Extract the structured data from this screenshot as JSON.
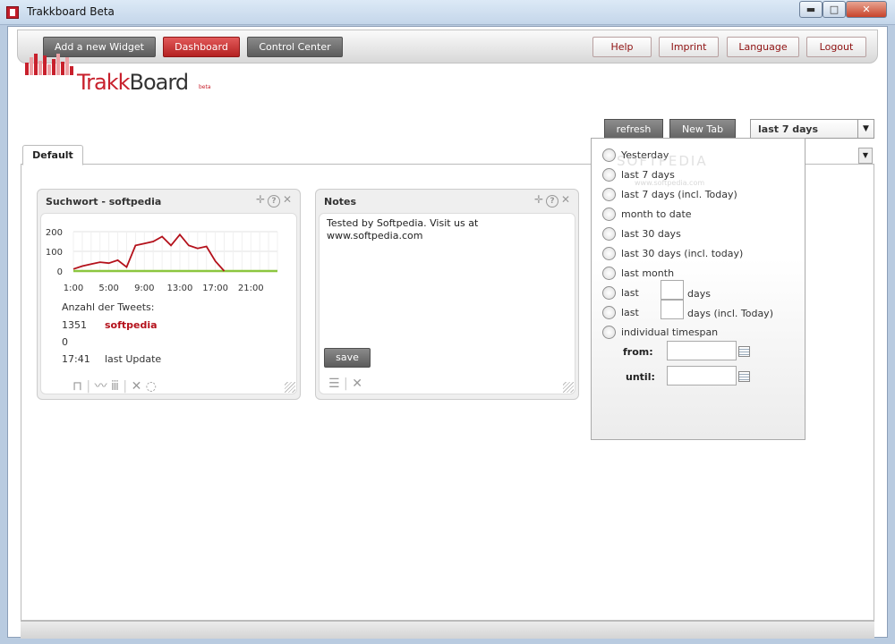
{
  "window": {
    "title": "Trakkboard Beta",
    "min": "▬",
    "max": "□",
    "close": "✕"
  },
  "nav": {
    "add_widget": "Add a new Widget",
    "dashboard": "Dashboard",
    "control_center": "Control Center",
    "help": "Help",
    "imprint": "Imprint",
    "language": "Language",
    "logout": "Logout"
  },
  "logo": {
    "text_a": "Trakk",
    "text_b": "Board",
    "beta": "beta"
  },
  "toolbar": {
    "refresh": "refresh",
    "new_tab": "New Tab",
    "range_selected": "last 7 days"
  },
  "tabs": [
    {
      "label": "Default"
    }
  ],
  "widget1": {
    "title": "Suchwort - softpedia",
    "y_ticks": [
      "200",
      "100",
      "0"
    ],
    "x_ticks": [
      "1:00",
      "5:00",
      "9:00",
      "13:00",
      "17:00",
      "21:00"
    ],
    "tweets_label": "Anzahl der Tweets:",
    "rows": [
      {
        "n": "1351",
        "name": "softpedia"
      },
      {
        "n": "0",
        "name": ""
      }
    ],
    "update_time": "17:41",
    "update_label": "last Update"
  },
  "chart_data": {
    "type": "line",
    "ylim": [
      0,
      200
    ],
    "x_hours": [
      0,
      1,
      2,
      3,
      4,
      5,
      6,
      7,
      8,
      9,
      10,
      11,
      12,
      13,
      14,
      15,
      16,
      17,
      18,
      19,
      20,
      21,
      22,
      23
    ],
    "series": [
      {
        "color": "#b4111b",
        "values": [
          10,
          25,
          35,
          45,
          40,
          55,
          20,
          130,
          140,
          150,
          175,
          130,
          185,
          130,
          115,
          125,
          50,
          0,
          0,
          0,
          0,
          0,
          0,
          0
        ]
      },
      {
        "color": "#8cc63f",
        "values": [
          0,
          0,
          0,
          0,
          0,
          0,
          0,
          0,
          0,
          0,
          0,
          0,
          0,
          0,
          0,
          0,
          0,
          0,
          0,
          0,
          0,
          0,
          0,
          0
        ]
      }
    ]
  },
  "widget2": {
    "title": "Notes",
    "text": "Tested by Softpedia. Visit us at www.softpedia.com",
    "save": "save"
  },
  "range_options": {
    "yesterday": "Yesterday",
    "last7": "last 7 days",
    "last7_today": "last 7 days (incl. Today)",
    "month_to_date": "month to date",
    "last30": "last 30 days",
    "last30_today": "last 30 days (incl. today)",
    "last_month": "last month",
    "last_n": "last",
    "days": "days",
    "days_today": "days (incl. Today)",
    "individual": "individual timespan",
    "from": "from:",
    "until": "until:"
  },
  "watermark": {
    "big": "SOFTPEDIA",
    "small": "www.softpedia.com"
  },
  "colors": {
    "accent": "#c8202c",
    "nav_dark": "#6b6b6b",
    "line": "#b4111b",
    "baseline": "#8cc63f"
  }
}
